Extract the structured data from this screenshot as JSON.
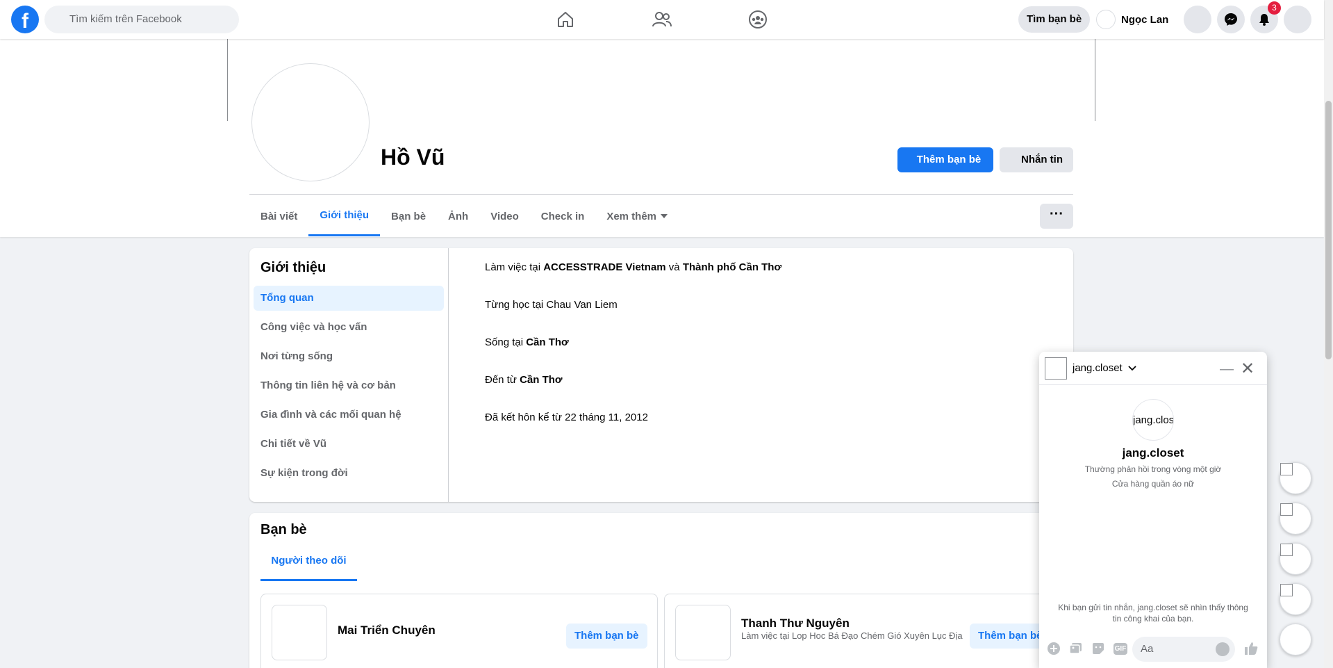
{
  "topbar": {
    "logo": "f",
    "search_placeholder": "Tìm kiếm trên Facebook",
    "find_friends": "Tìm bạn bè",
    "user_name": "Ngọc Lan",
    "notification_count": "3"
  },
  "profile": {
    "name": "Hồ Vũ",
    "add_friend": "Thêm bạn bè",
    "message": "Nhắn tin",
    "more": "···"
  },
  "tabs": [
    {
      "label": "Bài viết"
    },
    {
      "label": "Giới thiệu"
    },
    {
      "label": "Bạn bè"
    },
    {
      "label": "Ảnh"
    },
    {
      "label": "Video"
    },
    {
      "label": "Check in"
    },
    {
      "label": "Xem thêm"
    }
  ],
  "intro": {
    "title": "Giới thiệu",
    "menu": [
      "Tổng quan",
      "Công việc và học vấn",
      "Nơi từng sống",
      "Thông tin liên hệ và cơ bản",
      "Gia đình và các mối quan hệ",
      "Chi tiết về Vũ",
      "Sự kiện trong đời"
    ],
    "work_prefix": "Làm việc tại ",
    "work_company": "ACCESSTRADE Vietnam",
    "work_and": " và ",
    "work_place": "Thành phố Cần Thơ",
    "studied": "Từng học tại Chau Van Liem",
    "lives_prefix": "Sống tại ",
    "lives_place": "Cần Thơ",
    "from_prefix": "Đến từ ",
    "from_place": "Cần Thơ",
    "married": "Đã kết hôn kể từ 22 tháng 11, 2012"
  },
  "friends": {
    "title": "Bạn bè",
    "tab": "Người theo dõi",
    "items": [
      {
        "name": "Mai Triển Chuyên",
        "sub": "",
        "button": "Thêm bạn bè"
      },
      {
        "name": "Thanh Thư Nguyên",
        "sub": "Làm việc tại Lop Hoc Bá Đạo Chém Gió Xuyên Lục Địa",
        "button": "Thêm bạn bè"
      }
    ]
  },
  "chat": {
    "page_name": "jang.closet",
    "avatar_alt": "jang.clos",
    "response_time": "Thường phản hồi trong vòng một giờ",
    "category": "Cửa hàng quần áo nữ",
    "note": "Khi bạn gửi tin nhắn, jang.closet sẽ nhìn thấy thông tin công khai của bạn.",
    "input_placeholder": "Aa",
    "gif_label": "GIF"
  },
  "colors": {
    "brand": "#1877f2",
    "badge": "#e41e3f"
  }
}
